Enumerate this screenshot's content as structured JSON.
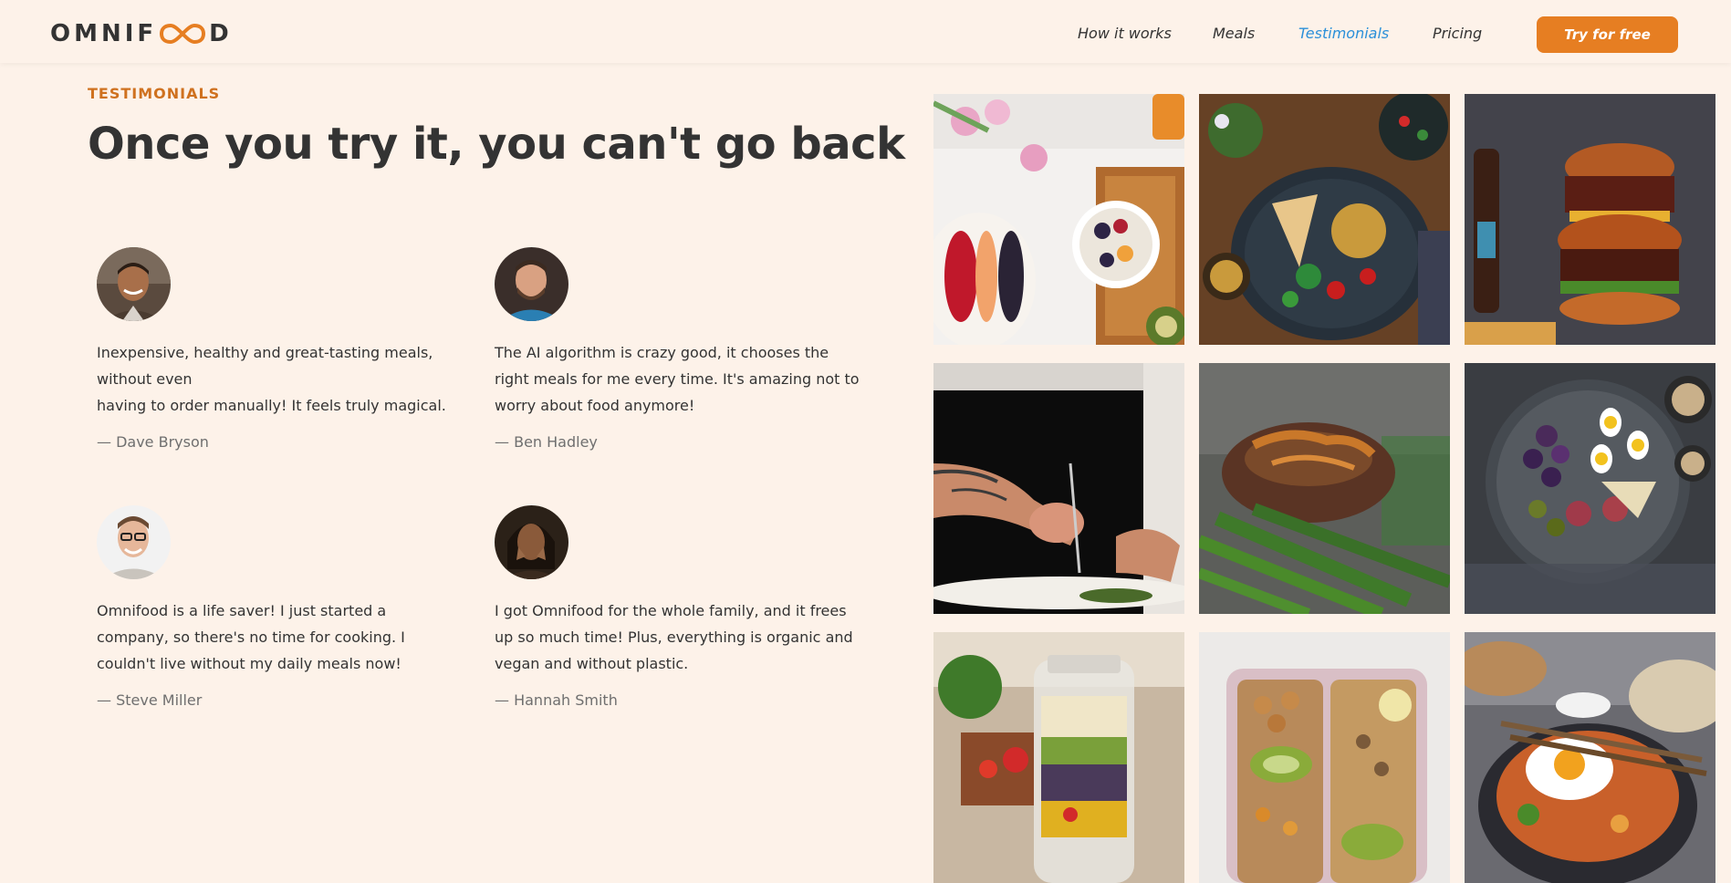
{
  "brand": {
    "logo_text_left": "OMNIF",
    "logo_text_right": "D"
  },
  "nav": {
    "items": [
      "How it works",
      "Meals",
      "Testimonials",
      "Pricing"
    ],
    "active": "Testimonials",
    "cta_label": "Try for free"
  },
  "section": {
    "subheading": "Testimonials",
    "heading": "Once you try it, you can't go back"
  },
  "testimonials": [
    {
      "quote_lines": [
        "Inexpensive, healthy and great-tasting meals, without even",
        "having to order manually! It feels truly magical."
      ],
      "author": "— Dave Bryson",
      "avatar": "dave-bryson-avatar"
    },
    {
      "quote_lines": [
        "The AI algorithm is crazy good, it chooses the right meals for me every time. It's amazing not to worry about food anymore!"
      ],
      "author": "— Ben Hadley",
      "avatar": "ben-hadley-avatar"
    },
    {
      "quote_lines": [
        "Omnifood is a life saver! I just started a company, so there's no time for cooking. I couldn't live without my daily meals now!"
      ],
      "author": "— Steve Miller",
      "avatar": "steve-miller-avatar"
    },
    {
      "quote_lines": [
        "I got Omnifood for the whole family, and it frees up so much time! Plus, everything is organic and vegan and without plastic."
      ],
      "author": "— Hannah Smith",
      "avatar": "hannah-smith-avatar"
    }
  ],
  "gallery": [
    "fruit-and-yogurt-bowls-photo",
    "chickpea-salad-bowl-photo",
    "burger-photo",
    "chef-plating-photo",
    "steak-with-asparagus-photo",
    "figs-and-eggs-platter-photo",
    "salad-jar-photo",
    "meal-prep-boxes-photo",
    "egg-noodle-bowl-photo"
  ],
  "colors": {
    "background": "#fdf2e9",
    "accent": "#e67e22",
    "accent_dark": "#cf711f",
    "active_link": "#2b90d9",
    "text": "#333333",
    "muted": "#6f6f6f"
  }
}
